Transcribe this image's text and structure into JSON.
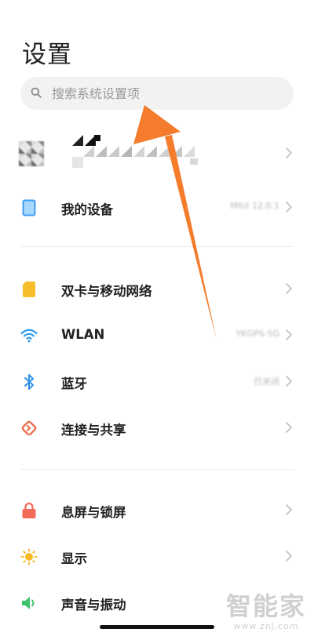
{
  "header": {
    "title": "设置"
  },
  "search": {
    "placeholder": "搜索系统设置项"
  },
  "rows": {
    "my_device": {
      "label": "我的设备",
      "value": "MIUI 12.0.1"
    },
    "dual_sim": {
      "label": "双卡与移动网络"
    },
    "wlan": {
      "label": "WLAN",
      "value": "YKGPS-5G"
    },
    "bluetooth": {
      "label": "蓝牙",
      "value": "已关闭"
    },
    "connection": {
      "label": "连接与共享"
    },
    "lock_screen": {
      "label": "息屏与锁屏"
    },
    "display": {
      "label": "显示"
    },
    "sound": {
      "label": "声音与振动"
    }
  },
  "icons": {
    "search": "search-icon",
    "my_device": "tablet-icon",
    "dual_sim": "sim-card-icon",
    "wlan": "wifi-icon",
    "bluetooth": "bluetooth-icon",
    "connection": "share-icon",
    "lock_screen": "lock-icon",
    "display": "sun-icon",
    "sound": "speaker-icon"
  },
  "colors": {
    "arrow": "#f47c2c",
    "my_device_icon": "#3d9df2",
    "dual_sim_icon": "#f7bd2a",
    "wlan_icon": "#2f9bf0",
    "bluetooth_icon": "#2f8fe8",
    "connection_icon": "#f06a4c",
    "lock_icon": "#f26b5b",
    "display_icon": "#f7b928",
    "sound_icon": "#3ec26c"
  },
  "watermark": {
    "main": "智能家",
    "url": "www.znj.com"
  }
}
